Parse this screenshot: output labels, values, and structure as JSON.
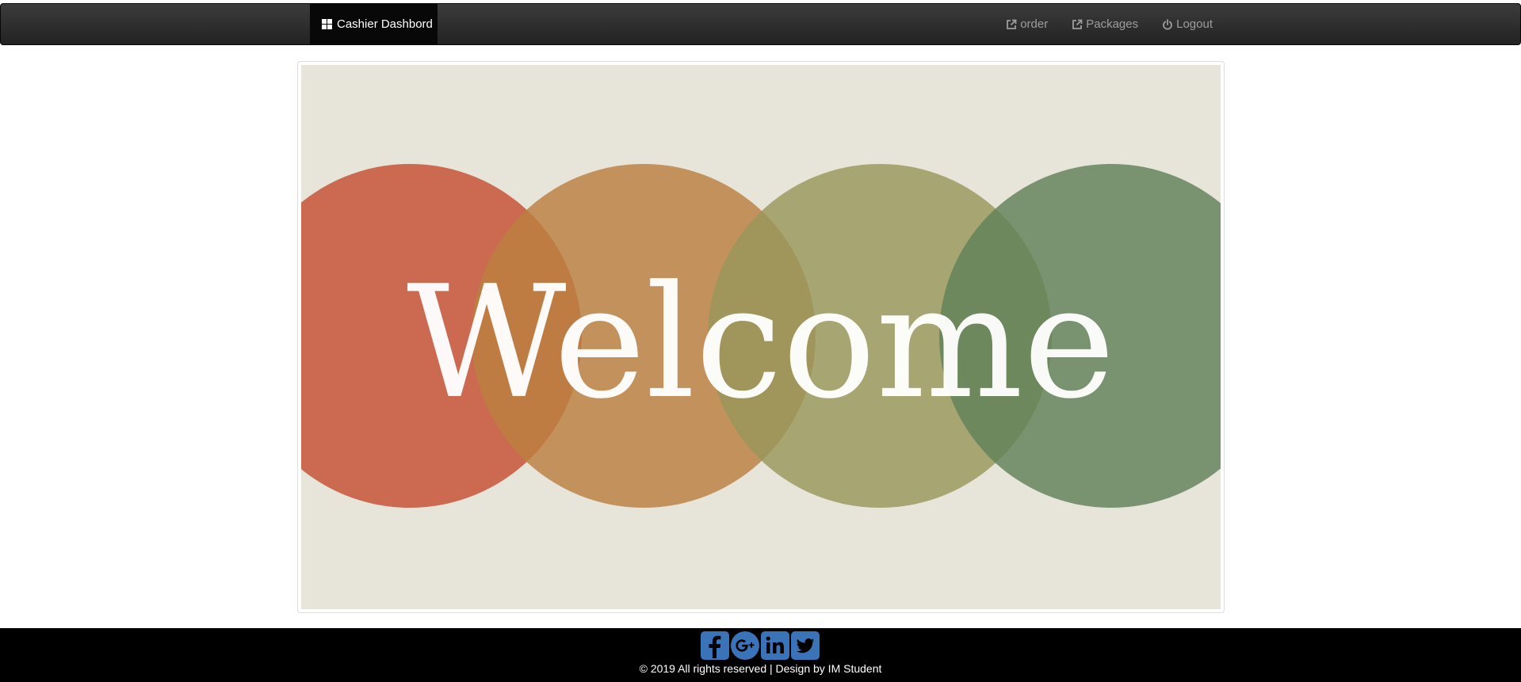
{
  "navbar": {
    "brand_label": "Cashier Dashbord",
    "brand_icon": "dashboard-grid-icon",
    "links": [
      {
        "label": "order",
        "icon": "external-link-icon"
      },
      {
        "label": "Packages",
        "icon": "external-link-icon"
      },
      {
        "label": "Logout",
        "icon": "power-icon"
      }
    ]
  },
  "banner": {
    "text": "Welcome",
    "background_color": "#e7e4da",
    "circle_colors": [
      "#d9583a",
      "#d08f4a",
      "#a8aa6a",
      "#6a9168"
    ]
  },
  "footer": {
    "social_icons": [
      "facebook-icon",
      "google-plus-icon",
      "linkedin-icon",
      "twitter-icon"
    ],
    "social_color": "#3b73b9",
    "copyright": "© 2019 All rights reserved | Design by IM Student"
  }
}
